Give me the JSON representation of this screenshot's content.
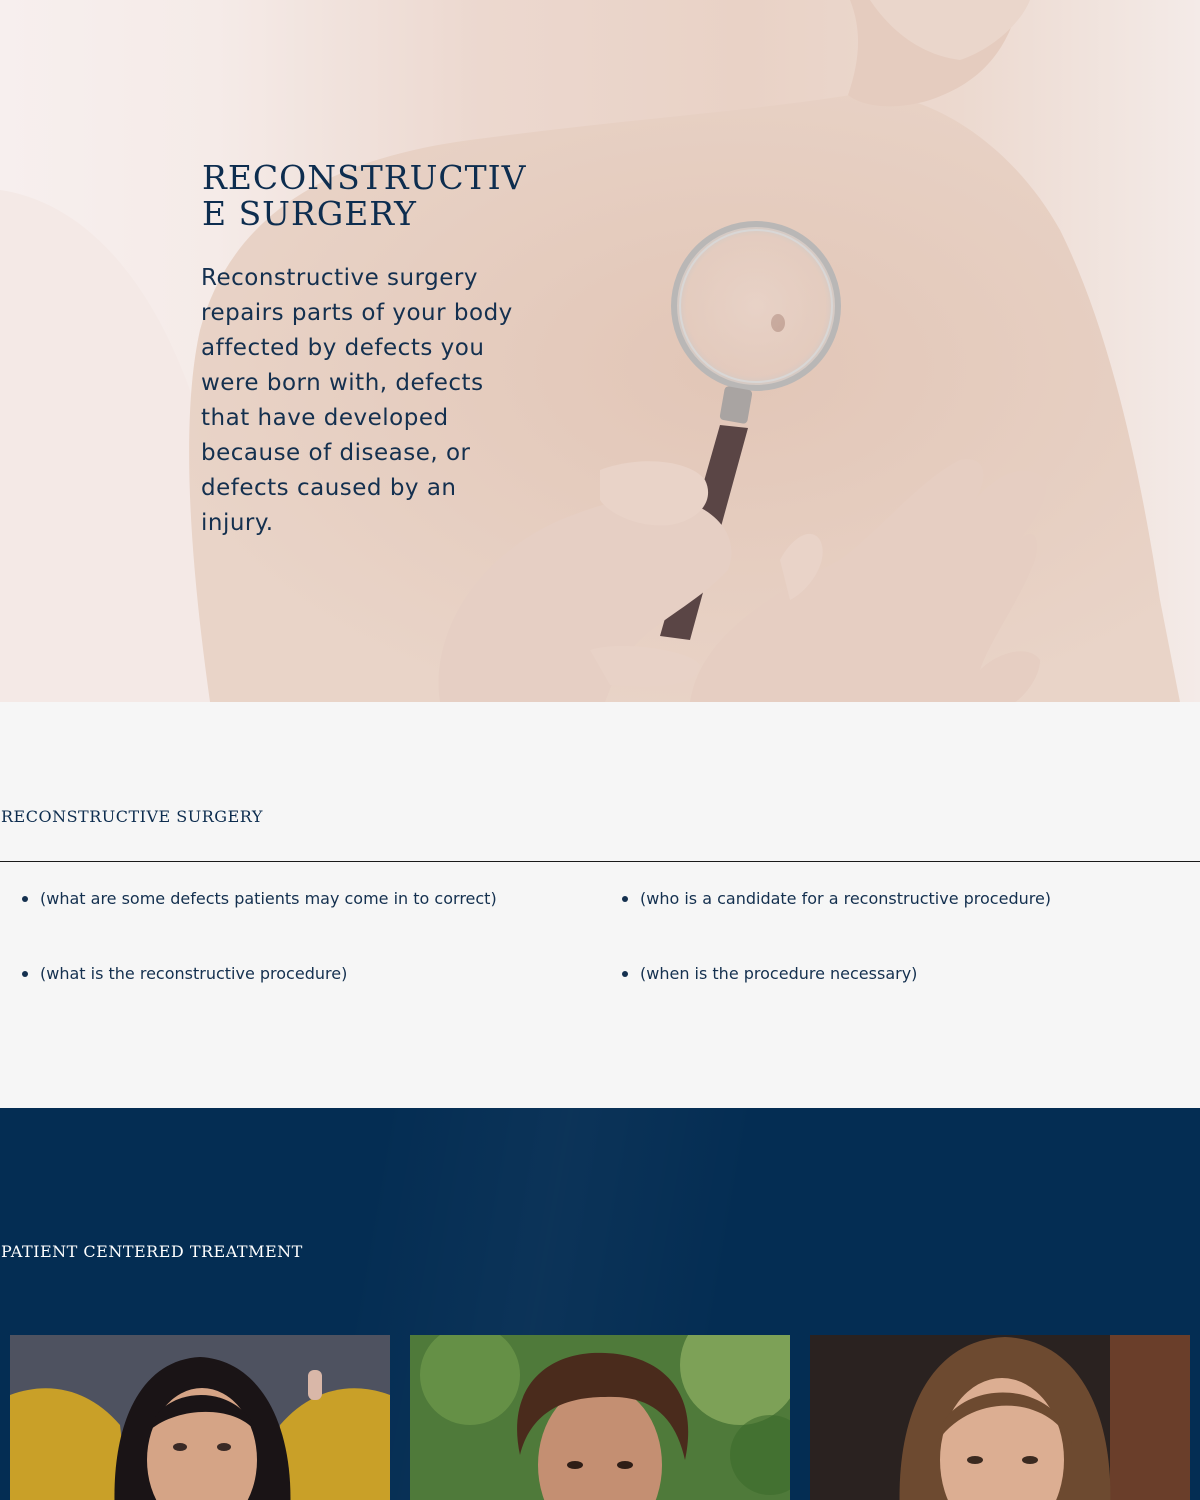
{
  "hero": {
    "title": "RECONSTRUCTIVE SURGERY",
    "body": "Reconstructive surgery repairs parts of your body affected by defects you were born with, defects that have developed because of disease, or defects caused by an injury."
  },
  "info": {
    "heading": "RECONSTRUCTIVE SURGERY",
    "questions": [
      "(what are some defects patients may come in to correct)",
      "(who is a candidate for a reconstructive procedure)",
      "(what is the reconstructive procedure)",
      "(when is the procedure necessary)"
    ]
  },
  "patients": {
    "heading": "PATIENT CENTERED TREATMENT"
  },
  "colors": {
    "navy": "#042d53",
    "text_navy": "#0d2d4f",
    "light_bg": "#f6f6f6"
  }
}
